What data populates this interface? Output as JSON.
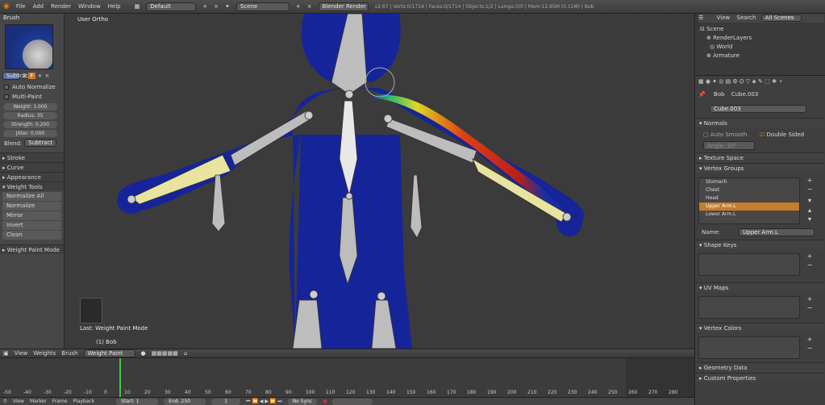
{
  "top": {
    "menus": [
      "File",
      "Add",
      "Render",
      "Window",
      "Help"
    ],
    "layout": "Default",
    "scene": "Scene",
    "engine": "Blender Render",
    "info": "v2.67 | Verts:0/1714 | Faces:0/1714 | Objects:1/2 | Lamps:0/0 | Mem:12.95M (0.11M) | Bob"
  },
  "left": {
    "brush_header": "Brush",
    "brush_name": "Subtract",
    "brush_users": "2",
    "brush_f": "F",
    "auto_normalize": "Auto Normalize",
    "multi_paint": "Multi-Paint",
    "weight": "Weight: 1.000",
    "radius": "Radius: 35",
    "strength": "Strength: 0.200",
    "jitter": "Jitter: 0.000",
    "blend_label": "Blend:",
    "blend_value": "Subtract",
    "stroke": "Stroke",
    "curve": "Curve",
    "appearance": "Appearance",
    "weight_tools": "Weight Tools",
    "tools": [
      "Normalize All",
      "Normalize",
      "Mirror",
      "Invert",
      "Clean"
    ],
    "mode_panel": "Weight Paint Mode"
  },
  "viewport": {
    "view_label": "User Ortho",
    "last_op": "Last: Weight Paint Mode",
    "object_label": "(1) Bob"
  },
  "header3d": {
    "menus": [
      "View",
      "Weights",
      "Brush"
    ],
    "mode": "Weight Paint"
  },
  "timeline": {
    "ticks": [
      "-50",
      "-40",
      "-30",
      "-20",
      "-10",
      "0",
      "10",
      "20",
      "30",
      "40",
      "50",
      "60",
      "70",
      "80",
      "90",
      "100",
      "110",
      "120",
      "130",
      "140",
      "150",
      "160",
      "170",
      "180",
      "190",
      "200",
      "210",
      "220",
      "230",
      "240",
      "250",
      "260",
      "270",
      "280"
    ],
    "menus": [
      "View",
      "Marker",
      "Frame",
      "Playback"
    ],
    "start": "Start: 1",
    "end": "End: 250",
    "current": "1",
    "sync": "No Sync"
  },
  "outliner": {
    "menus": [
      "View",
      "Search"
    ],
    "filter": "All Scenes",
    "items": [
      "Scene",
      "RenderLayers",
      "World",
      "Armature"
    ]
  },
  "props": {
    "object_name": "Bob",
    "mesh_name": "Cube.003",
    "datablock": "Cube.003",
    "normals": "Normals",
    "auto_smooth": "Auto Smooth",
    "double_sided": "Double Sided",
    "angle": "Angle: 30°",
    "texture_space": "Texture Space",
    "vertex_groups": "Vertex Groups",
    "groups": [
      "Stomach",
      "Chest",
      "Head",
      "Upper Arm.L",
      "Lower Arm.L"
    ],
    "name_label": "Name:",
    "name_value": "Upper Arm.L",
    "shape_keys": "Shape Keys",
    "uv_maps": "UV Maps",
    "vertex_colors": "Vertex Colors",
    "geometry_data": "Geometry Data",
    "custom_properties": "Custom Properties"
  },
  "colors": {
    "accent": "#c47d2b",
    "bone": "#d8d07a",
    "body": "#15239a"
  }
}
